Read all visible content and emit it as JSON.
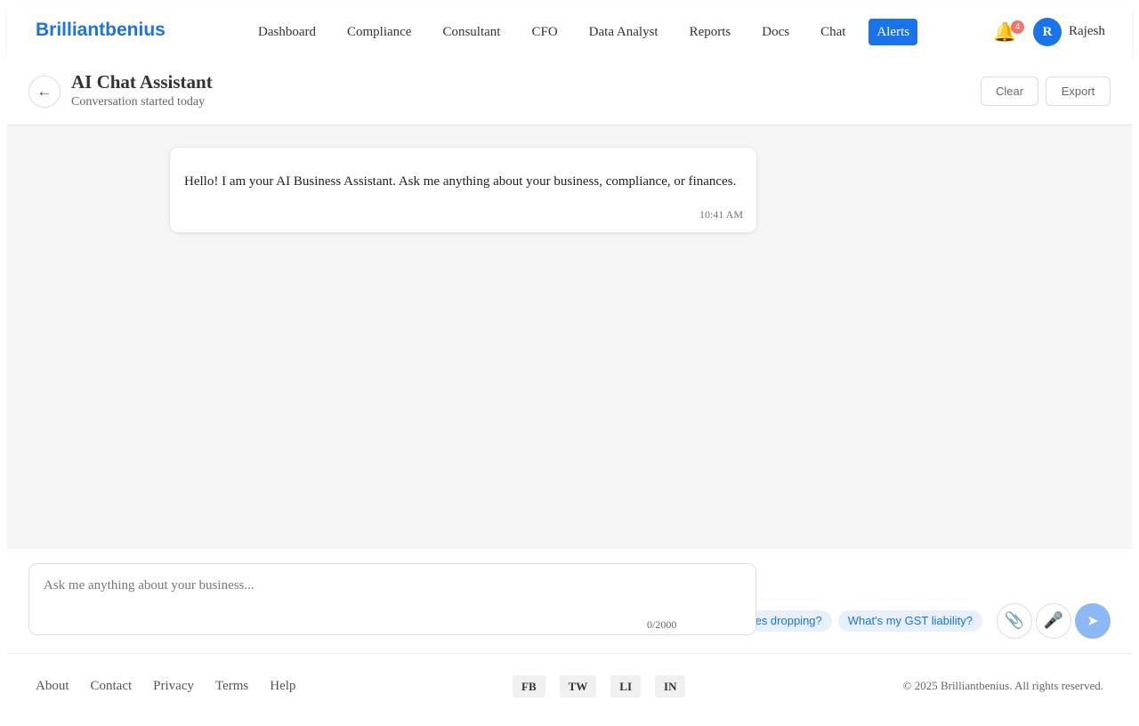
{
  "brand": "Brilliantbenius",
  "nav": {
    "items": [
      "Dashboard",
      "Compliance",
      "Consultant",
      "CFO",
      "Data Analyst",
      "Reports",
      "Docs",
      "Chat",
      "Alerts"
    ],
    "active": "Alerts"
  },
  "notifications": {
    "count": "4"
  },
  "user": {
    "initial": "R",
    "name": "Rajesh"
  },
  "chat": {
    "back_icon": "←",
    "title": "AI Chat Assistant",
    "subtitle": "Conversation started today",
    "clear_label": "Clear",
    "export_label": "Export"
  },
  "messages": [
    {
      "sender": "assistant",
      "text": "Hello! I am your AI Business Assistant. Ask me anything about your business, compliance, or finances.",
      "time": "10:41 AM"
    }
  ],
  "composer": {
    "placeholder": "Ask me anything about your business...",
    "value": "",
    "char_count": "0/2000",
    "suggestions": [
      "Why are sales dropping?",
      "What's my GST liability?"
    ],
    "icons": {
      "attach": "paperclip-icon",
      "mic": "microphone-icon",
      "send": "send-icon"
    }
  },
  "footer": {
    "links": [
      "About",
      "Contact",
      "Privacy",
      "Terms",
      "Help"
    ],
    "socials": [
      "FB",
      "TW",
      "LI",
      "IN"
    ],
    "copyright": "© 2025 Brilliantbenius. All rights reserved."
  },
  "colors": {
    "accent": "#1a73e8",
    "badge": "#f4736a",
    "send_disabled": "#8db8f4",
    "chip_bg": "#e8f0fe"
  }
}
